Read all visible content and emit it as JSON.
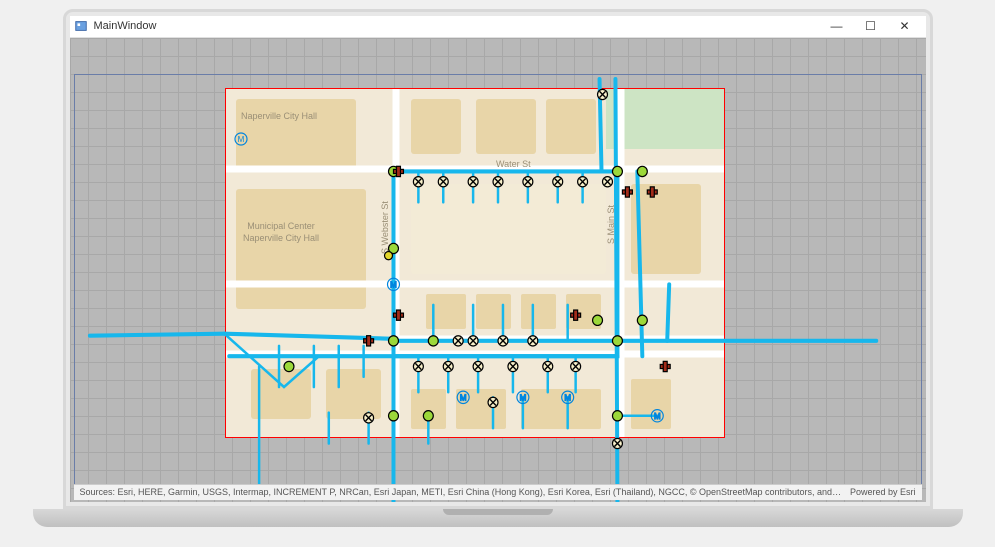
{
  "window": {
    "title": "MainWindow",
    "minimize_glyph": "—",
    "maximize_glyph": "☐",
    "close_glyph": "✕"
  },
  "footer": {
    "attribution": "Sources: Esri, HERE, Garmin, USGS, Intermap, INCREMENT P, NRCan, Esri Japan, METI, Esri China (Hong Kong), Esri Korea, Esri (Thailand), NGCC, © OpenStreetMap contributors, and the GIS User Community",
    "powered_by": "Powered by Esri"
  },
  "basemap_labels": {
    "city_hall_poi": "Naperville City Hall",
    "municipal_center": "Municipal Center",
    "city_hall": "Naperville City Hall",
    "water_st": "Water St",
    "webster_st": "S Webster St",
    "main_st": "S Main St",
    "m_glyph": "M"
  },
  "colors": {
    "pipe": "#17b7ec",
    "green_node": "#9cd83a",
    "cross_node": "#a32c1a",
    "xmark_node": "#f7efc9",
    "extent_border": "#ff0000"
  }
}
